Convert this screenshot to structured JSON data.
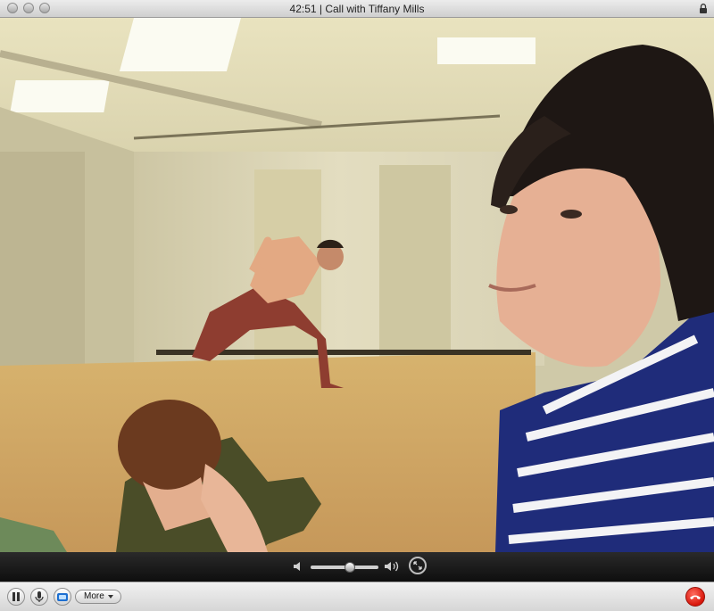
{
  "window": {
    "title": "42:51 | Call with Tiffany Mills",
    "lock_icon": "lock-icon"
  },
  "video": {
    "description_icon": "live-video-feed"
  },
  "controls": {
    "volume_level": 0.6,
    "icons": [
      "volume-low-icon",
      "volume-high-icon",
      "fullscreen-icon"
    ]
  },
  "toolbar": {
    "more_label": "More",
    "icons": [
      "pause-icon",
      "microphone-icon",
      "camera-icon",
      "end-call-icon"
    ]
  },
  "colors": {
    "end_call": "#d8160b",
    "camera_button": "#1d6fd1"
  }
}
